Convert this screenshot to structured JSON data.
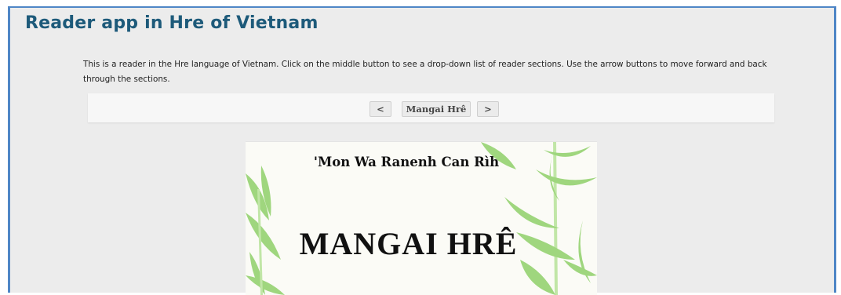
{
  "app": {
    "title": "Reader app in Hre of Vietnam",
    "description": "This is a reader in the Hre language of Vietnam. Click on the middle button to see a drop-down list of reader sections. Use the arrow buttons to move forward and back through the sections."
  },
  "nav": {
    "prev_label": "<",
    "section_label": "Mangai Hrê",
    "next_label": ">"
  },
  "book": {
    "subtitle": "'Mon Wa Ranenh Can Rìh",
    "title": "MANGAI HRÊ"
  },
  "colors": {
    "accent_border": "#4f86c6",
    "title_color": "#1d5a7a",
    "leaf_green": "#8fd06a"
  },
  "icons": {
    "page_illustration": "bamboo-leaves-icon"
  }
}
